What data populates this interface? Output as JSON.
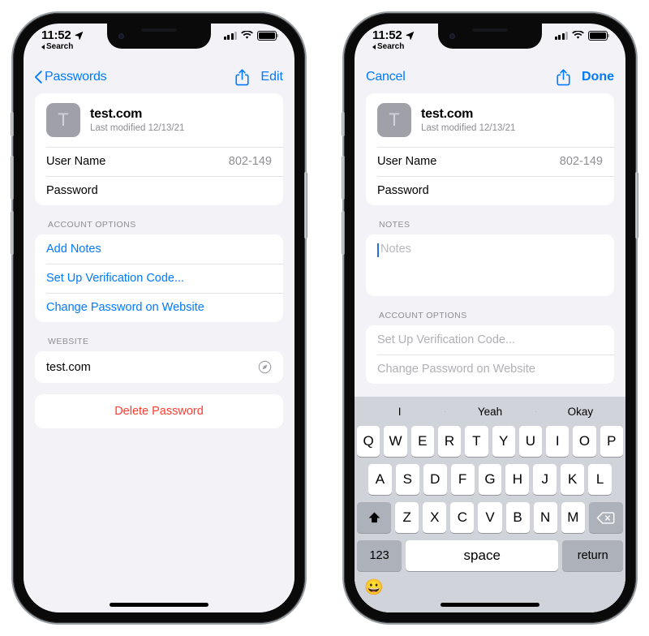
{
  "status_bar": {
    "time": "11:52",
    "back_label": "Search",
    "location_icon": "location-arrow-icon",
    "signal_icon": "cellular-bars-icon",
    "wifi_icon": "wifi-icon",
    "battery_icon": "battery-full-icon"
  },
  "phone_left": {
    "nav": {
      "back_label": "Passwords",
      "back_icon": "chevron-left-icon",
      "share_icon": "share-icon",
      "action_label": "Edit"
    },
    "header": {
      "avatar_letter": "T",
      "title": "test.com",
      "subtitle": "Last modified 12/13/21"
    },
    "credentials": [
      {
        "label": "User Name",
        "value": "802-149"
      },
      {
        "label": "Password",
        "value": ""
      }
    ],
    "account_options_title": "ACCOUNT OPTIONS",
    "account_options": [
      {
        "label": "Add Notes"
      },
      {
        "label": "Set Up Verification Code..."
      },
      {
        "label": "Change Password on Website"
      }
    ],
    "website_title": "WEBSITE",
    "website_value": "test.com",
    "website_icon": "safari-compass-icon",
    "delete_label": "Delete Password"
  },
  "phone_right": {
    "nav": {
      "cancel_label": "Cancel",
      "share_icon": "share-icon",
      "done_label": "Done"
    },
    "header": {
      "avatar_letter": "T",
      "title": "test.com",
      "subtitle": "Last modified 12/13/21"
    },
    "credentials": [
      {
        "label": "User Name",
        "value": "802-149"
      },
      {
        "label": "Password",
        "value": ""
      }
    ],
    "notes_title": "NOTES",
    "notes_placeholder": "Notes",
    "account_options_title": "ACCOUNT OPTIONS",
    "account_options": [
      {
        "label": "Set Up Verification Code..."
      },
      {
        "label": "Change Password on Website"
      }
    ]
  },
  "keyboard": {
    "suggestions": [
      "I",
      "Yeah",
      "Okay"
    ],
    "row1": [
      "Q",
      "W",
      "E",
      "R",
      "T",
      "Y",
      "U",
      "I",
      "O",
      "P"
    ],
    "row2": [
      "A",
      "S",
      "D",
      "F",
      "G",
      "H",
      "J",
      "K",
      "L"
    ],
    "row3": [
      "Z",
      "X",
      "C",
      "V",
      "B",
      "N",
      "M"
    ],
    "shift_icon": "shift-up-icon",
    "delete_icon": "backspace-delete-icon",
    "numbers_label": "123",
    "space_label": "space",
    "return_label": "return",
    "emoji_icon": "emoji-smiley-icon"
  },
  "colors": {
    "accent_blue": "#007aff",
    "danger_red": "#ff3b30",
    "page_bg": "#f2f2f7",
    "keyboard_bg": "#d1d3da",
    "secondary_text": "#8e8e93"
  }
}
